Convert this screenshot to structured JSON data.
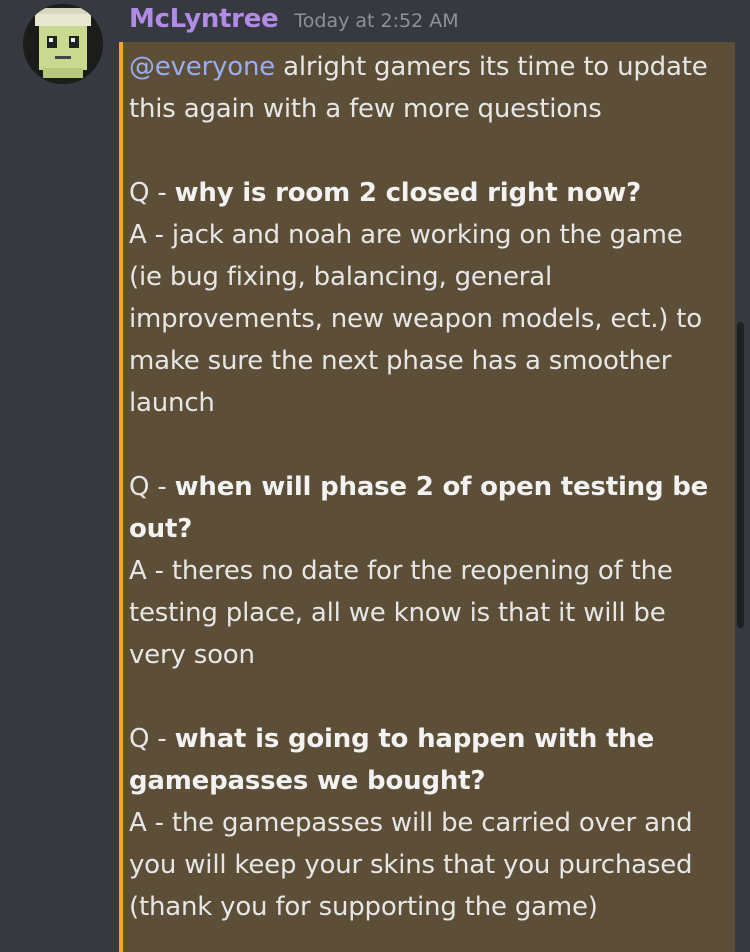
{
  "message": {
    "author": "McLyntree",
    "timestamp": "Today at 2:52 AM",
    "mention": "@everyone",
    "intro_line1": " alright gamers its time to update",
    "intro_line2": "this again with a few more questions",
    "qa": [
      {
        "q_prefix": "Q - ",
        "question_lines": [
          "why is room 2 closed right now?"
        ],
        "answer_lines": [
          "A - jack and noah are working on the game",
          "(ie bug fixing, balancing, general",
          "improvements, new weapon models, ect.) to",
          "make sure the next phase has a smoother",
          "launch"
        ]
      },
      {
        "q_prefix": "Q - ",
        "question_lines": [
          "when will phase 2 of open testing be",
          "out?"
        ],
        "answer_lines": [
          "A - theres no date for the reopening of the",
          "testing place, all we know is that it will be",
          "very soon"
        ]
      },
      {
        "q_prefix": "Q - ",
        "question_lines": [
          "what is going to happen with the",
          "gamepasses we bought?"
        ],
        "answer_lines": [
          "A - the gamepasses will be carried over and",
          "you will keep your skins that you purchased",
          "(thank you for supporting the game)"
        ]
      }
    ]
  },
  "colors": {
    "background": "#36393f",
    "username": "#b18be6",
    "mention": "#99aef0",
    "highlight_bg": "#5c4e37",
    "highlight_bar": "#faa61a"
  }
}
